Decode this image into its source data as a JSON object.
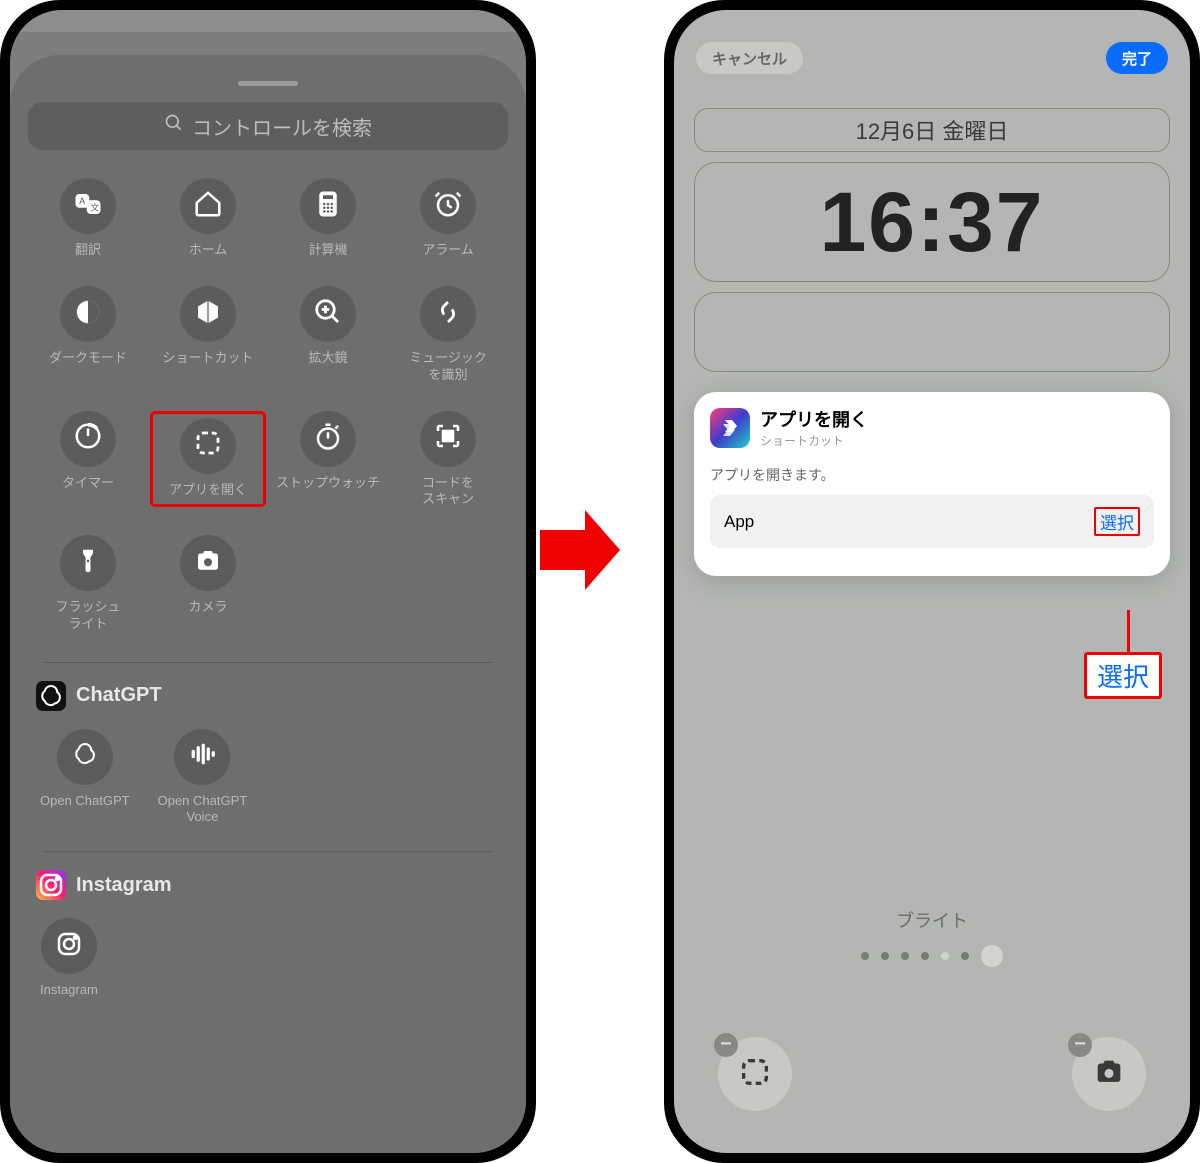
{
  "gallery": {
    "search_placeholder": "コントロールを検索",
    "controls": [
      {
        "id": "translate",
        "label": "翻訳"
      },
      {
        "id": "home",
        "label": "ホーム"
      },
      {
        "id": "calculator",
        "label": "計算機"
      },
      {
        "id": "alarm",
        "label": "アラーム"
      },
      {
        "id": "darkmode",
        "label": "ダークモード"
      },
      {
        "id": "shortcut",
        "label": "ショートカット"
      },
      {
        "id": "magnifier",
        "label": "拡大鏡"
      },
      {
        "id": "music-recognition",
        "label": "ミュージック\nを識別"
      },
      {
        "id": "timer",
        "label": "タイマー"
      },
      {
        "id": "open-app",
        "label": "アプリを開く"
      },
      {
        "id": "stopwatch",
        "label": "ストップウォッチ"
      },
      {
        "id": "scan-code",
        "label": "コードを\nスキャン"
      },
      {
        "id": "flashlight",
        "label": "フラッシュ\nライト"
      },
      {
        "id": "camera",
        "label": "カメラ"
      }
    ],
    "section_chatgpt": {
      "title": "ChatGPT",
      "items": [
        {
          "id": "open-chatgpt",
          "label": "Open ChatGPT"
        },
        {
          "id": "open-chatgpt-voice",
          "label": "Open ChatGPT\nVoice"
        }
      ]
    },
    "section_instagram": {
      "title": "Instagram",
      "item_label": "Instagram"
    }
  },
  "lockscreen": {
    "cancel": "キャンセル",
    "done": "完了",
    "date": "12月6日 金曜日",
    "time": "16:37",
    "popup": {
      "title": "アプリを開く",
      "subtitle": "ショートカット",
      "desc": "アプリを開きます。",
      "row_label": "App",
      "row_value": "選択"
    },
    "zoom_select": "選択",
    "type_label": "ブライト",
    "minus": "−"
  }
}
